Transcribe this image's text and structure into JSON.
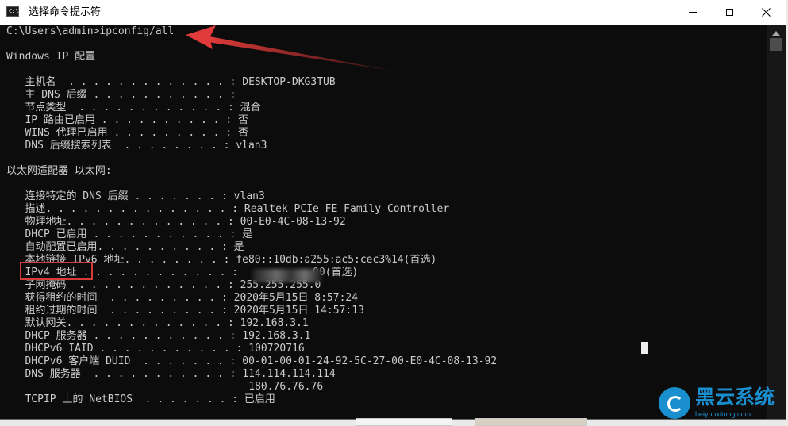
{
  "window": {
    "title": "选择命令提示符",
    "icon_label": "C:\\"
  },
  "console_lines": [
    "C:\\Users\\admin>ipconfig/all",
    "",
    "Windows IP 配置",
    "",
    "   主机名  . . . . . . . . . . . . . : DESKTOP-DKG3TUB",
    "   主 DNS 后缀 . . . . . . . . . . . :",
    "   节点类型  . . . . . . . . . . . . : 混合",
    "   IP 路由已启用 . . . . . . . . . . : 否",
    "   WINS 代理已启用 . . . . . . . . . : 否",
    "   DNS 后缀搜索列表  . . . . . . . . : vlan3",
    "",
    "以太网适配器 以太网:",
    "",
    "   连接特定的 DNS 后缀 . . . . . . . : vlan3",
    "   描述. . . . . . . . . . . . . . . : Realtek PCIe FE Family Controller",
    "   物理地址. . . . . . . . . . . . . : 00-E0-4C-08-13-92",
    "   DHCP 已启用 . . . . . . . . . . . : 是",
    "   自动配置已启用. . . . . . . . . . : 是",
    "   本地链接 IPv6 地址. . . . . . . . : fe80::10db:a255:ac5:cec3%14(首选)",
    "   IPv4 地址 . . . . . . . . . . . . :           .00(首选)",
    "   子网掩码  . . . . . . . . . . . . : 255.255.255.0",
    "   获得租约的时间  . . . . . . . . . : 2020年5月15日 8:57:24",
    "   租约过期的时间  . . . . . . . . . : 2020年5月15日 14:57:13",
    "   默认网关. . . . . . . . . . . . . : 192.168.3.1",
    "   DHCP 服务器 . . . . . . . . . . . : 192.168.3.1",
    "   DHCPv6 IAID . . . . . . . . . . . : 100720716",
    "   DHCPv6 客户端 DUID  . . . . . . . : 00-01-00-01-24-92-5C-27-00-E0-4C-08-13-92",
    "   DNS 服务器  . . . . . . . . . . . : 114.114.114.114",
    "                                       180.76.76.76",
    "   TCPIP 上的 NetBIOS  . . . . . . . : 已启用"
  ],
  "annotations": {
    "arrow_color": "#e03a3a",
    "highlight_color": "#d63b3b"
  },
  "watermark": {
    "name": "黑云系统",
    "url": "heiyunxitong.com",
    "color": "#1a8fd0"
  }
}
